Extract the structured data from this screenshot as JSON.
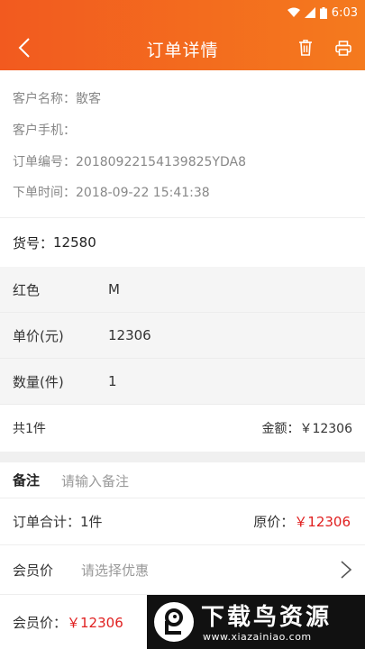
{
  "status_bar": {
    "time": "6:03"
  },
  "header": {
    "title": "订单详情"
  },
  "info": {
    "customer_name_label": "客户名称：",
    "customer_name": "散客",
    "customer_phone_label": "客户手机：",
    "customer_phone": "",
    "order_no_label": "订单编号：",
    "order_no": "20180922154139825YDA8",
    "order_time_label": "下单时间：",
    "order_time": "2018-09-22 15:41:38"
  },
  "goods": {
    "label": "货号：",
    "value": "12580"
  },
  "specs": [
    {
      "key": "红色",
      "value": "M"
    },
    {
      "key": "单价(元)",
      "value": "12306"
    },
    {
      "key": "数量(件)",
      "value": "1"
    }
  ],
  "totals": {
    "count_text": "共1件",
    "amount_label": "金额：",
    "amount": "￥12306"
  },
  "remark": {
    "label": "备注",
    "placeholder": "请输入备注"
  },
  "summary": {
    "order_total": "订单合计：1件",
    "original_label": "原价：",
    "original_price": "￥12306"
  },
  "member": {
    "label": "会员价",
    "placeholder": "请选择优惠"
  },
  "bottom": {
    "label": "会员价：",
    "price": "￥12306"
  },
  "watermark": {
    "title": "下载鸟资源",
    "url": "www.xiazainiao.com"
  },
  "colors": {
    "accent": "#f25a1f",
    "price_red": "#e02020"
  }
}
